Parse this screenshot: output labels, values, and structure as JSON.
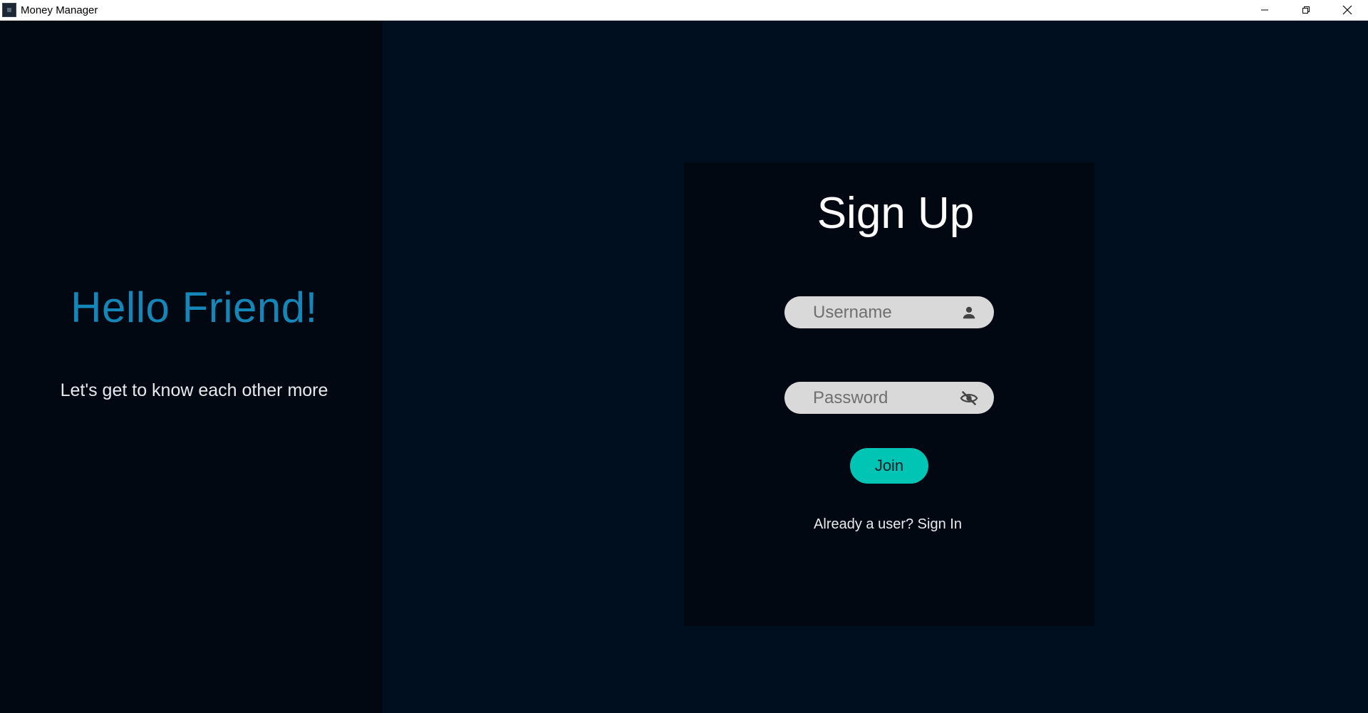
{
  "window": {
    "title": "Money Manager",
    "controls": {
      "minimize": "minimize-icon",
      "maximize": "restore-icon",
      "close": "close-icon"
    }
  },
  "left": {
    "heading": "Hello Friend!",
    "subtitle": "Let's get to know each other more",
    "heading_color": "#1487b8"
  },
  "signup": {
    "title": "Sign Up",
    "username": {
      "value": "",
      "placeholder": "Username",
      "icon": "person-icon"
    },
    "password": {
      "value": "",
      "placeholder": "Password",
      "icon": "eye-off-icon"
    },
    "join_label": "Join",
    "join_color": "#00c4b4",
    "signin_text": "Already a user? Sign In"
  },
  "colors": {
    "background": "#000f20",
    "left_panel": "#010812",
    "card": "#010812",
    "field": "#d9d9d9"
  }
}
